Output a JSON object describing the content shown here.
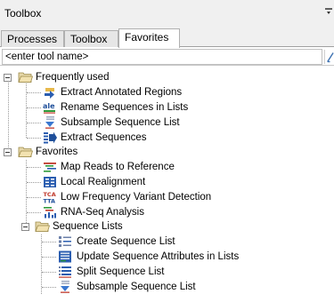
{
  "window": {
    "title": "Toolbox"
  },
  "tabs": [
    {
      "label": "Processes",
      "active": false
    },
    {
      "label": "Toolbox",
      "active": false
    },
    {
      "label": "Favorites",
      "active": true
    }
  ],
  "search": {
    "placeholder": "<enter tool name>",
    "value": ""
  },
  "tree": {
    "frequently_used": {
      "label": "Frequently used",
      "items": [
        {
          "label": "Extract Annotated Regions",
          "icon": "extract-annotated-regions-icon"
        },
        {
          "label": "Rename Sequences in Lists",
          "icon": "rename-sequences-icon"
        },
        {
          "label": "Subsample Sequence List",
          "icon": "subsample-sequence-list-icon"
        },
        {
          "label": "Extract Sequences",
          "icon": "extract-sequences-icon"
        }
      ]
    },
    "favorites": {
      "label": "Favorites",
      "items": [
        {
          "label": "Map Reads to Reference",
          "icon": "map-reads-icon"
        },
        {
          "label": "Local Realignment",
          "icon": "local-realignment-icon"
        },
        {
          "label": "Low Frequency Variant Detection",
          "icon": "variant-detection-icon"
        },
        {
          "label": "RNA-Seq Analysis",
          "icon": "rna-seq-icon"
        }
      ],
      "sequence_lists": {
        "label": "Sequence Lists",
        "items": [
          {
            "label": "Create Sequence List",
            "icon": "create-sequence-list-icon"
          },
          {
            "label": "Update Sequence Attributes in Lists",
            "icon": "update-sequence-attributes-icon"
          },
          {
            "label": "Split Sequence List",
            "icon": "split-sequence-list-icon"
          },
          {
            "label": "Subsample Sequence List",
            "icon": "subsample-sequence-list-icon"
          }
        ]
      }
    }
  },
  "colors": {
    "folder_yellow": "#f2d36b",
    "icon_blue": "#2a5db0",
    "icon_green": "#2f9a3a",
    "icon_red": "#c0392b"
  }
}
